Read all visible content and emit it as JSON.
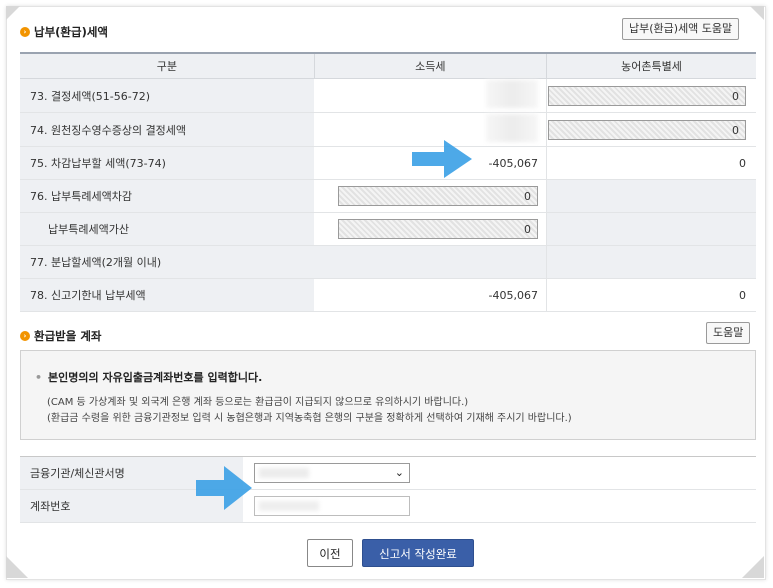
{
  "section1": {
    "title": "납부(환급)세액",
    "help_label": "납부(환급)세액 도움말",
    "headers": [
      "구분",
      "소득세",
      "농어촌특별세"
    ],
    "rows": [
      {
        "label": "73. 결정세액(51-56-72)",
        "income": "",
        "rural": "0"
      },
      {
        "label": "74. 원천징수영수증상의 결정세액",
        "income": "",
        "rural": "0"
      },
      {
        "label": "75. 차감납부할 세액(73-74)",
        "income": "-405,067",
        "rural": "0"
      },
      {
        "label": "76. 납부특례세액차감",
        "income": "0",
        "rural": ""
      },
      {
        "label": "납부특례세액가산",
        "income": "0",
        "rural": ""
      },
      {
        "label": "77. 분납할세액(2개월 이내)",
        "income": "",
        "rural": ""
      },
      {
        "label": "78. 신고기한내 납부세액",
        "income": "-405,067",
        "rural": "0"
      }
    ]
  },
  "section2": {
    "title": "환급받을 계좌",
    "help_label": "도움말",
    "notice_head": "본인명의의 자유입출금계좌번호를 입력합니다.",
    "notice_line1": "(CAM 등 가상계좌 및 외국계 은행 계좌 등으로는 환급금이 지급되지 않으므로 유의하시기 바랍니다.)",
    "notice_line2": "(환급금 수령을 위한 금융기관정보 입력 시 농협은행과 지역농축협 은행의 구분을 정확하게 선택하여 기재해 주시기 바랍니다.)",
    "bank_label": "금융기관/체신관서명",
    "account_label": "계좌번호"
  },
  "buttons": {
    "prev": "이전",
    "complete": "신고서 작성완료"
  },
  "colors": {
    "accent": "#3a5fa8",
    "bullet": "#f29400",
    "arrow": "#3aa0e6"
  }
}
